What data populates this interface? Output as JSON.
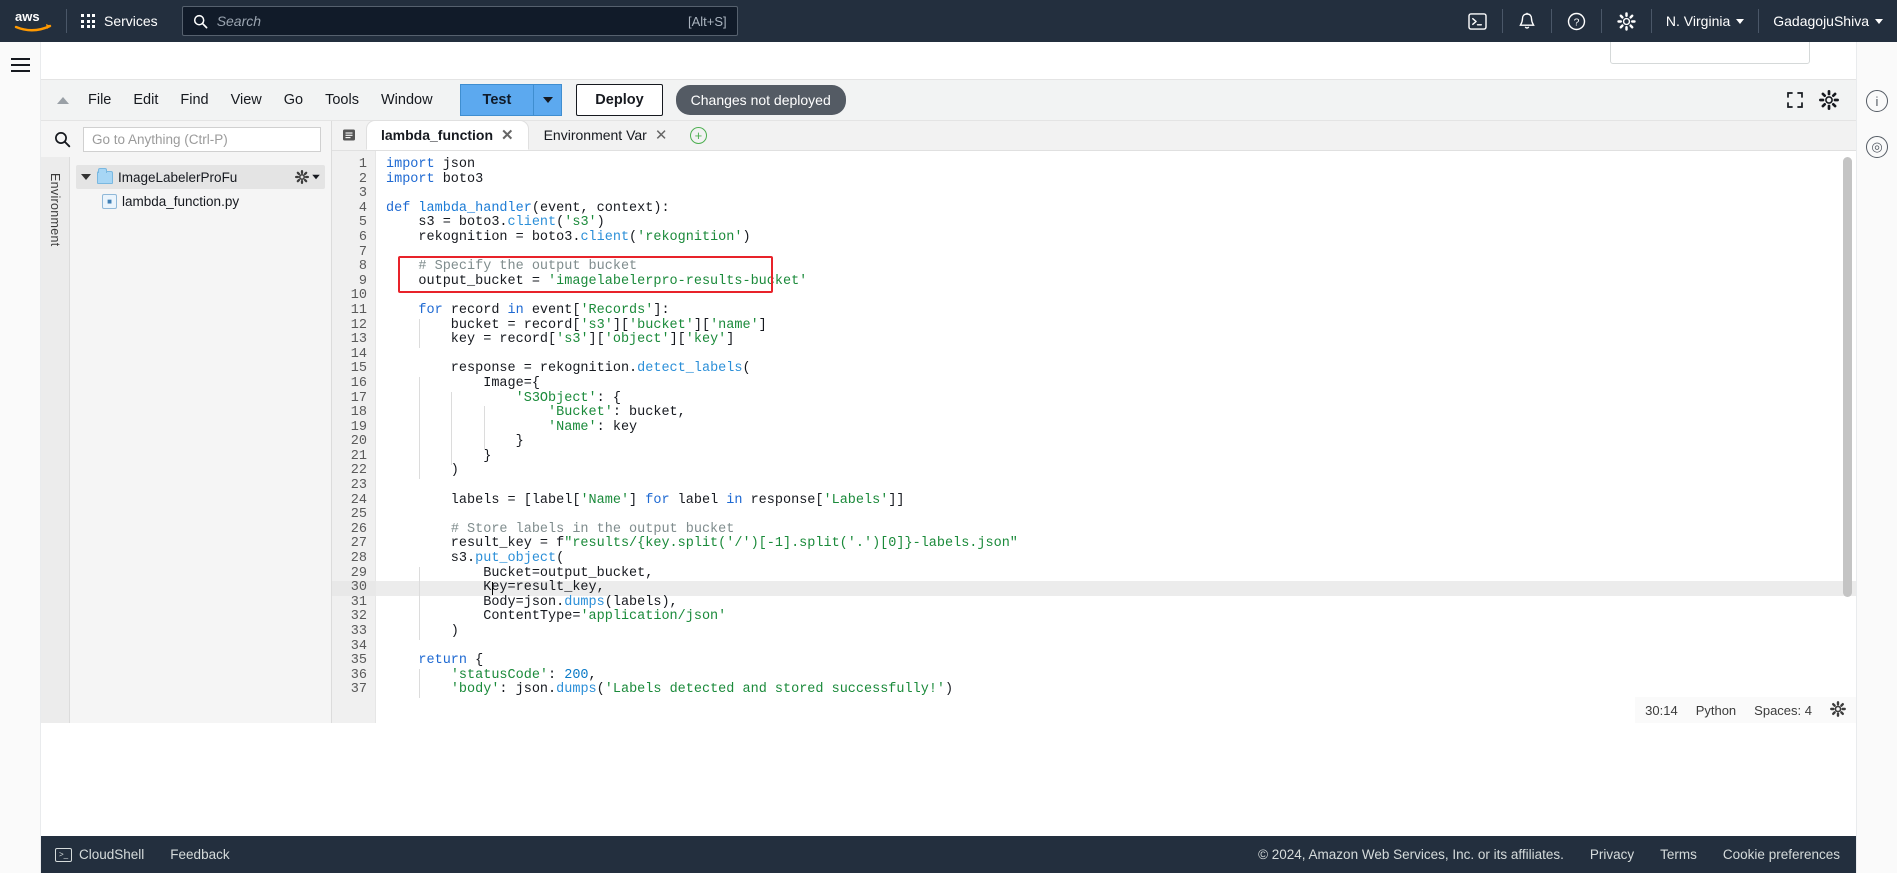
{
  "aws_nav": {
    "logo": "aws-logo",
    "services_label": "Services",
    "search_placeholder": "Search",
    "search_value": "",
    "search_shortcut": "[Alt+S]",
    "cloudshell_icon": "cloudshell-icon",
    "notifications_icon": "bell-icon",
    "help_icon": "question-circle-icon",
    "settings_icon": "gear-icon",
    "region": "N. Virginia",
    "account": "GadagojuShiva"
  },
  "toolbar": {
    "menus": [
      "File",
      "Edit",
      "Find",
      "View",
      "Go",
      "Tools",
      "Window"
    ],
    "test_label": "Test",
    "deploy_label": "Deploy",
    "changes_badge": "Changes not deployed",
    "fullscreen_icon": "expand-icon",
    "settings_icon": "gear-icon"
  },
  "explorer": {
    "search_icon": "search-icon",
    "goto_placeholder": "Go to Anything (Ctrl-P)",
    "goto_value": "",
    "side_tab_label": "Environment",
    "tree": [
      {
        "name": "ImageLabelerProFu",
        "type": "folder",
        "selected": true,
        "has_gear": true
      },
      {
        "name": "lambda_function.py",
        "type": "file",
        "selected": false,
        "has_gear": false
      }
    ]
  },
  "tabs": {
    "menu_icon": "tab-list-icon",
    "add_label": "+",
    "items": [
      {
        "label": "lambda_function",
        "active": true
      },
      {
        "label": "Environment Var",
        "active": false
      }
    ]
  },
  "editor": {
    "cursor_line": 30,
    "lines": [
      {
        "n": 1,
        "tokens": [
          [
            "kw",
            "import"
          ],
          [
            "t",
            " json"
          ]
        ]
      },
      {
        "n": 2,
        "tokens": [
          [
            "kw",
            "import"
          ],
          [
            "t",
            " boto3"
          ]
        ]
      },
      {
        "n": 3,
        "tokens": []
      },
      {
        "n": 4,
        "tokens": [
          [
            "kw",
            "def"
          ],
          [
            "t",
            " "
          ],
          [
            "fn",
            "lambda_handler"
          ],
          [
            "t",
            "(event, context):"
          ]
        ]
      },
      {
        "n": 5,
        "tokens": [
          [
            "t",
            "    s3 = boto3."
          ],
          [
            "mt",
            "client"
          ],
          [
            "t",
            "("
          ],
          [
            "str",
            "'s3'"
          ],
          [
            "t",
            ")"
          ]
        ]
      },
      {
        "n": 6,
        "tokens": [
          [
            "t",
            "    rekognition = boto3."
          ],
          [
            "mt",
            "client"
          ],
          [
            "t",
            "("
          ],
          [
            "str",
            "'rekognition'"
          ],
          [
            "t",
            ")"
          ]
        ]
      },
      {
        "n": 7,
        "tokens": []
      },
      {
        "n": 8,
        "tokens": [
          [
            "t",
            "    "
          ],
          [
            "cm",
            "# Specify the output bucket"
          ]
        ]
      },
      {
        "n": 9,
        "tokens": [
          [
            "t",
            "    output_bucket = "
          ],
          [
            "str",
            "'imagelabelerpro-results-bucket'"
          ]
        ]
      },
      {
        "n": 10,
        "tokens": []
      },
      {
        "n": 11,
        "tokens": [
          [
            "t",
            "    "
          ],
          [
            "kw",
            "for"
          ],
          [
            "t",
            " record "
          ],
          [
            "kw",
            "in"
          ],
          [
            "t",
            " event["
          ],
          [
            "str",
            "'Records'"
          ],
          [
            "t",
            "]:"
          ]
        ]
      },
      {
        "n": 12,
        "tokens": [
          [
            "t",
            "        bucket = record["
          ],
          [
            "str",
            "'s3'"
          ],
          [
            "t",
            "]["
          ],
          [
            "str",
            "'bucket'"
          ],
          [
            "t",
            "]["
          ],
          [
            "str",
            "'name'"
          ],
          [
            "t",
            "]"
          ]
        ]
      },
      {
        "n": 13,
        "tokens": [
          [
            "t",
            "        key = record["
          ],
          [
            "str",
            "'s3'"
          ],
          [
            "t",
            "]["
          ],
          [
            "str",
            "'object'"
          ],
          [
            "t",
            "]["
          ],
          [
            "str",
            "'key'"
          ],
          [
            "t",
            "]"
          ]
        ]
      },
      {
        "n": 14,
        "tokens": []
      },
      {
        "n": 15,
        "tokens": [
          [
            "t",
            "        response = rekognition."
          ],
          [
            "mt",
            "detect_labels"
          ],
          [
            "t",
            "("
          ]
        ]
      },
      {
        "n": 16,
        "tokens": [
          [
            "t",
            "            Image={"
          ]
        ]
      },
      {
        "n": 17,
        "tokens": [
          [
            "t",
            "                "
          ],
          [
            "str",
            "'S3Object'"
          ],
          [
            "t",
            ": {"
          ]
        ]
      },
      {
        "n": 18,
        "tokens": [
          [
            "t",
            "                    "
          ],
          [
            "str",
            "'Bucket'"
          ],
          [
            "t",
            ": bucket,"
          ]
        ]
      },
      {
        "n": 19,
        "tokens": [
          [
            "t",
            "                    "
          ],
          [
            "str",
            "'Name'"
          ],
          [
            "t",
            ": key"
          ]
        ]
      },
      {
        "n": 20,
        "tokens": [
          [
            "t",
            "                }"
          ]
        ]
      },
      {
        "n": 21,
        "tokens": [
          [
            "t",
            "            }"
          ]
        ]
      },
      {
        "n": 22,
        "tokens": [
          [
            "t",
            "        )"
          ]
        ]
      },
      {
        "n": 23,
        "tokens": []
      },
      {
        "n": 24,
        "tokens": [
          [
            "t",
            "        labels = [label["
          ],
          [
            "str",
            "'Name'"
          ],
          [
            "t",
            "] "
          ],
          [
            "kw",
            "for"
          ],
          [
            "t",
            " label "
          ],
          [
            "kw",
            "in"
          ],
          [
            "t",
            " response["
          ],
          [
            "str",
            "'Labels'"
          ],
          [
            "t",
            "]]"
          ]
        ]
      },
      {
        "n": 25,
        "tokens": []
      },
      {
        "n": 26,
        "tokens": [
          [
            "t",
            "        "
          ],
          [
            "cm",
            "# Store labels in the output bucket"
          ]
        ]
      },
      {
        "n": 27,
        "tokens": [
          [
            "t",
            "        result_key = f"
          ],
          [
            "str",
            "\"results/{key.split('/')[-1].split('.')[0]}-labels.json\""
          ]
        ]
      },
      {
        "n": 28,
        "tokens": [
          [
            "t",
            "        s3."
          ],
          [
            "mt",
            "put_object"
          ],
          [
            "t",
            "("
          ]
        ]
      },
      {
        "n": 29,
        "tokens": [
          [
            "t",
            "            Bucket=output_bucket,"
          ]
        ]
      },
      {
        "n": 30,
        "tokens": [
          [
            "t",
            "            Key=result_key,"
          ]
        ]
      },
      {
        "n": 31,
        "tokens": [
          [
            "t",
            "            Body=json."
          ],
          [
            "mt",
            "dumps"
          ],
          [
            "t",
            "(labels),"
          ]
        ]
      },
      {
        "n": 32,
        "tokens": [
          [
            "t",
            "            ContentType="
          ],
          [
            "str",
            "'application/json'"
          ]
        ]
      },
      {
        "n": 33,
        "tokens": [
          [
            "t",
            "        )"
          ]
        ]
      },
      {
        "n": 34,
        "tokens": []
      },
      {
        "n": 35,
        "tokens": [
          [
            "t",
            "    "
          ],
          [
            "kw",
            "return"
          ],
          [
            "t",
            " {"
          ]
        ]
      },
      {
        "n": 36,
        "tokens": [
          [
            "t",
            "        "
          ],
          [
            "str",
            "'statusCode'"
          ],
          [
            "t",
            ": "
          ],
          [
            "num",
            "200"
          ],
          [
            "t",
            ","
          ]
        ]
      },
      {
        "n": 37,
        "tokens": [
          [
            "t",
            "        "
          ],
          [
            "str",
            "'body'"
          ],
          [
            "t",
            ": json."
          ],
          [
            "mt",
            "dumps"
          ],
          [
            "t",
            "("
          ],
          [
            "str",
            "'Labels detected and stored successfully!'"
          ],
          [
            "t",
            ")"
          ]
        ]
      }
    ],
    "annotation": {
      "type": "red-rectangle",
      "color": "#e8232a",
      "covers_lines": [
        8,
        9
      ]
    }
  },
  "status": {
    "position": "30:14",
    "language": "Python",
    "indent": "Spaces: 4",
    "gear_icon": "gear-icon"
  },
  "footer": {
    "cloudshell": "CloudShell",
    "feedback": "Feedback",
    "copyright": "© 2024, Amazon Web Services, Inc. or its affiliates.",
    "links": [
      "Privacy",
      "Terms",
      "Cookie preferences"
    ]
  }
}
